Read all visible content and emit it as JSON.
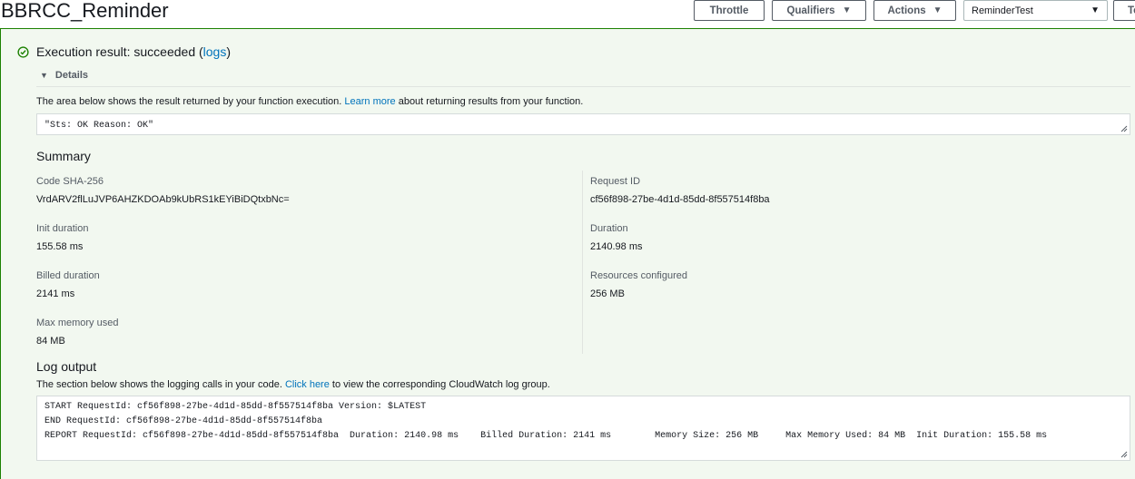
{
  "header": {
    "title": "BBRCC_Reminder",
    "buttons": {
      "throttle": "Throttle",
      "qualifiers": "Qualifiers",
      "actions": "Actions",
      "test_cut": "Te"
    },
    "test_event_select": "ReminderTest"
  },
  "result": {
    "status_prefix": "Execution result: succeeded (",
    "logs_link": "logs",
    "status_suffix": ")",
    "details_label": "Details",
    "description_pre": "The area below shows the result returned by your function execution.",
    "learn_more": "Learn more",
    "description_post": "about returning results from your function.",
    "output": "\"Sts: OK Reason: OK\""
  },
  "summary": {
    "heading": "Summary",
    "fields": {
      "code_sha_label": "Code SHA-256",
      "code_sha_value": "VrdARV2flLuJVP6AHZKDOAb9kUbRS1kEYiBiDQtxbNc=",
      "request_id_label": "Request ID",
      "request_id_value": "cf56f898-27be-4d1d-85dd-8f557514f8ba",
      "init_duration_label": "Init duration",
      "init_duration_value": "155.58 ms",
      "duration_label": "Duration",
      "duration_value": "2140.98 ms",
      "billed_duration_label": "Billed duration",
      "billed_duration_value": "2141 ms",
      "resources_label": "Resources configured",
      "resources_value": "256 MB",
      "max_memory_label": "Max memory used",
      "max_memory_value": "84 MB"
    }
  },
  "log_output": {
    "heading": "Log output",
    "description_pre": "The section below shows the logging calls in your code.",
    "click_here": "Click here",
    "description_post": "to view the corresponding CloudWatch log group.",
    "lines": [
      "START RequestId: cf56f898-27be-4d1d-85dd-8f557514f8ba Version: $LATEST",
      "END RequestId: cf56f898-27be-4d1d-85dd-8f557514f8ba",
      "REPORT RequestId: cf56f898-27be-4d1d-85dd-8f557514f8ba  Duration: 2140.98 ms    Billed Duration: 2141 ms        Memory Size: 256 MB     Max Memory Used: 84 MB  Init Duration: 155.58 ms"
    ]
  },
  "colors": {
    "success_green": "#1d8102",
    "panel_bg": "#f2f8f0",
    "link_blue": "#0073bb"
  },
  "icons": {
    "status": "check-circle-icon",
    "dropdown": "caret-down-icon",
    "details_toggle": "triangle-down-icon",
    "resize": "resize-handle-icon"
  }
}
